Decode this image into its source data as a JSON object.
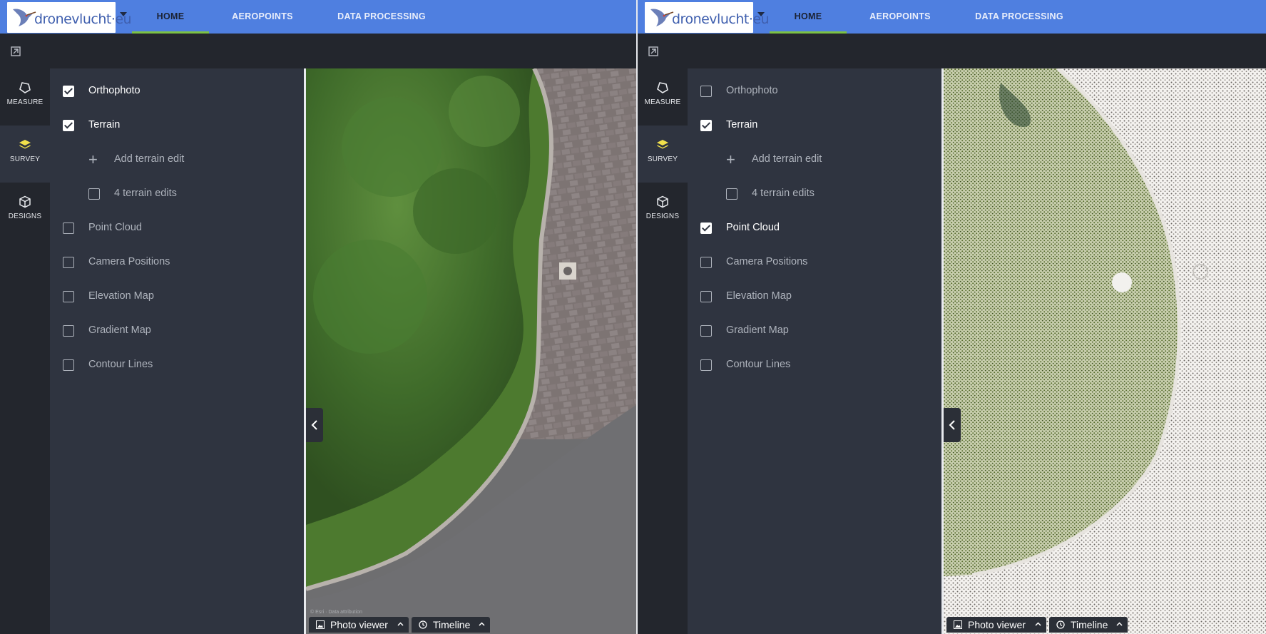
{
  "panes": [
    {
      "logo_text": "dronevlucht·eu",
      "nav": [
        "HOME",
        "AEROPOINTS",
        "DATA PROCESSING"
      ],
      "active_tab": "HOME",
      "rail": [
        "MEASURE",
        "SURVEY",
        "DESIGNS"
      ],
      "active_rail": "SURVEY",
      "layers": [
        {
          "label": "Orthophoto",
          "checked": true
        },
        {
          "label": "Terrain",
          "checked": true
        },
        {
          "label": "Add terrain edit",
          "type": "action"
        },
        {
          "label": "4 terrain edits",
          "checked": false,
          "type": "sub"
        },
        {
          "label": "Point Cloud",
          "checked": false
        },
        {
          "label": "Camera Positions",
          "checked": false
        },
        {
          "label": "Elevation Map",
          "checked": false
        },
        {
          "label": "Gradient Map",
          "checked": false
        },
        {
          "label": "Contour Lines",
          "checked": false
        }
      ],
      "map_view": "orthophoto",
      "attribution": "© Esri · Data attribution",
      "bottom": {
        "photo_viewer": "Photo viewer",
        "timeline": "Timeline"
      }
    },
    {
      "logo_text": "dronevlucht·eu",
      "nav": [
        "HOME",
        "AEROPOINTS",
        "DATA PROCESSING"
      ],
      "active_tab": "HOME",
      "rail": [
        "MEASURE",
        "SURVEY",
        "DESIGNS"
      ],
      "active_rail": "SURVEY",
      "layers": [
        {
          "label": "Orthophoto",
          "checked": false
        },
        {
          "label": "Terrain",
          "checked": true
        },
        {
          "label": "Add terrain edit",
          "type": "action"
        },
        {
          "label": "4 terrain edits",
          "checked": false,
          "type": "sub"
        },
        {
          "label": "Point Cloud",
          "checked": true
        },
        {
          "label": "Camera Positions",
          "checked": false
        },
        {
          "label": "Elevation Map",
          "checked": false
        },
        {
          "label": "Gradient Map",
          "checked": false
        },
        {
          "label": "Contour Lines",
          "checked": false
        }
      ],
      "map_view": "point-cloud",
      "bottom": {
        "photo_viewer": "Photo viewer",
        "timeline": "Timeline"
      }
    }
  ],
  "colors": {
    "nav": "#4f7fe0",
    "active_underline": "#7cc243",
    "survey_icon": "#f2e14b",
    "sidebar": "#23262d",
    "panel": "#2f3440"
  }
}
